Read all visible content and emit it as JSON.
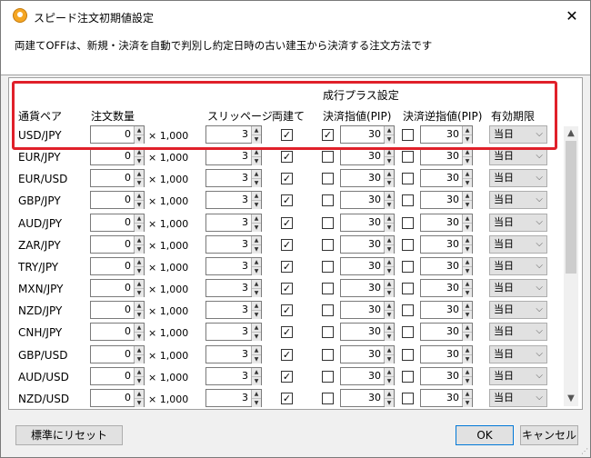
{
  "window": {
    "title": "スピード注文初期値設定",
    "close": "✕"
  },
  "description": "両建てOFFは、新規・決済を自動で判別し約定日時の古い建玉から決済する注文方法です",
  "headers": {
    "group": "成行プラス設定",
    "pair": "通貨ペア",
    "quantity": "注文数量",
    "slippage": "スリッページ",
    "hedge": "両建て",
    "limit": "決済指値(PIP)",
    "stop": "決済逆指値(PIP)",
    "expiry": "有効期限"
  },
  "multiplier": "× 1,000",
  "rows": [
    {
      "pair": "USD/JPY",
      "qty": "0",
      "slip": "3",
      "hedge": "✓",
      "limit_check": "✓",
      "limit": "30",
      "stop_check": "",
      "stop": "30",
      "expiry": "当日"
    },
    {
      "pair": "EUR/JPY",
      "qty": "0",
      "slip": "3",
      "hedge": "✓",
      "limit_check": "",
      "limit": "30",
      "stop_check": "",
      "stop": "30",
      "expiry": "当日"
    },
    {
      "pair": "EUR/USD",
      "qty": "0",
      "slip": "3",
      "hedge": "✓",
      "limit_check": "",
      "limit": "30",
      "stop_check": "",
      "stop": "30",
      "expiry": "当日"
    },
    {
      "pair": "GBP/JPY",
      "qty": "0",
      "slip": "3",
      "hedge": "✓",
      "limit_check": "",
      "limit": "30",
      "stop_check": "",
      "stop": "30",
      "expiry": "当日"
    },
    {
      "pair": "AUD/JPY",
      "qty": "0",
      "slip": "3",
      "hedge": "✓",
      "limit_check": "",
      "limit": "30",
      "stop_check": "",
      "stop": "30",
      "expiry": "当日"
    },
    {
      "pair": "ZAR/JPY",
      "qty": "0",
      "slip": "3",
      "hedge": "✓",
      "limit_check": "",
      "limit": "30",
      "stop_check": "",
      "stop": "30",
      "expiry": "当日"
    },
    {
      "pair": "TRY/JPY",
      "qty": "0",
      "slip": "3",
      "hedge": "✓",
      "limit_check": "",
      "limit": "30",
      "stop_check": "",
      "stop": "30",
      "expiry": "当日"
    },
    {
      "pair": "MXN/JPY",
      "qty": "0",
      "slip": "3",
      "hedge": "✓",
      "limit_check": "",
      "limit": "30",
      "stop_check": "",
      "stop": "30",
      "expiry": "当日"
    },
    {
      "pair": "NZD/JPY",
      "qty": "0",
      "slip": "3",
      "hedge": "✓",
      "limit_check": "",
      "limit": "30",
      "stop_check": "",
      "stop": "30",
      "expiry": "当日"
    },
    {
      "pair": "CNH/JPY",
      "qty": "0",
      "slip": "3",
      "hedge": "✓",
      "limit_check": "",
      "limit": "30",
      "stop_check": "",
      "stop": "30",
      "expiry": "当日"
    },
    {
      "pair": "GBP/USD",
      "qty": "0",
      "slip": "3",
      "hedge": "✓",
      "limit_check": "",
      "limit": "30",
      "stop_check": "",
      "stop": "30",
      "expiry": "当日"
    },
    {
      "pair": "AUD/USD",
      "qty": "0",
      "slip": "3",
      "hedge": "✓",
      "limit_check": "",
      "limit": "30",
      "stop_check": "",
      "stop": "30",
      "expiry": "当日"
    },
    {
      "pair": "NZD/USD",
      "qty": "0",
      "slip": "3",
      "hedge": "✓",
      "limit_check": "",
      "limit": "30",
      "stop_check": "",
      "stop": "30",
      "expiry": "当日"
    }
  ],
  "buttons": {
    "reset": "標準にリセット",
    "ok": "OK",
    "cancel": "キャンセル"
  },
  "colors": {
    "highlight": "#e0202a",
    "ok_border": "#0078d7"
  }
}
